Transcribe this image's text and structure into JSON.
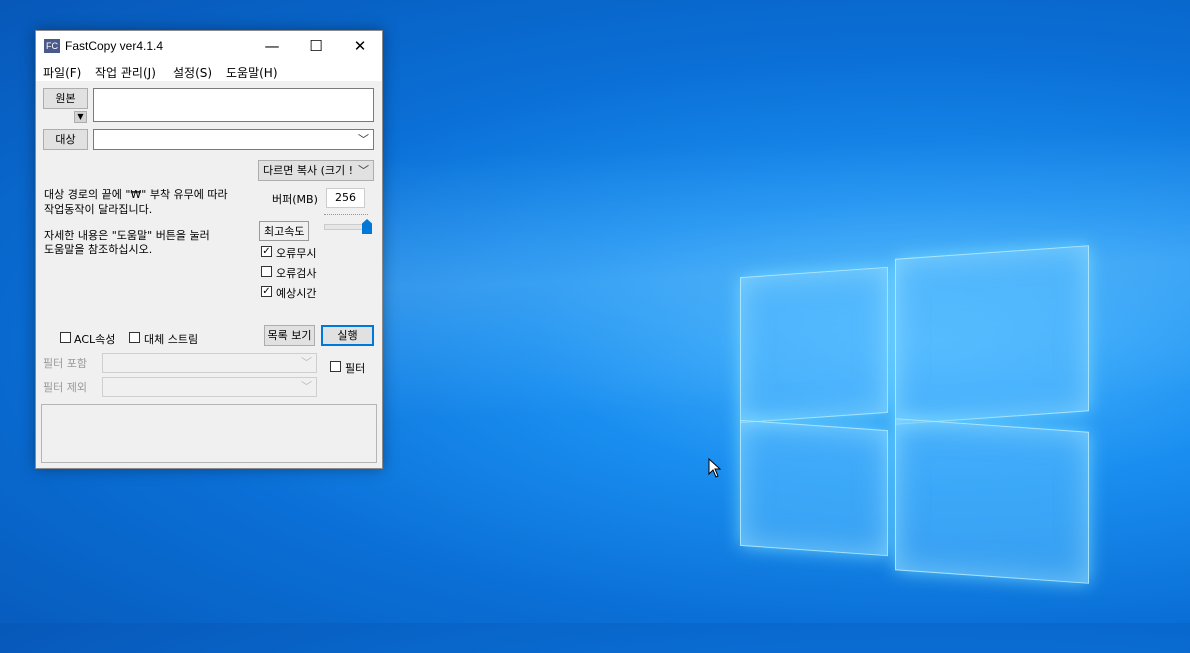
{
  "window": {
    "icon_text": "FC",
    "title": "FastCopy ver4.1.4",
    "minimize": "—",
    "maximize": "☐",
    "close": "✕"
  },
  "menu": [
    "파일(F)",
    "작업 관리(J)",
    "설정(S)",
    "도움말(H)"
  ],
  "source": {
    "button": "원본",
    "value": ""
  },
  "destination": {
    "button": "대상",
    "value": ""
  },
  "mode": {
    "selected": "다르면 복사 (크기 !"
  },
  "info": {
    "line1": "대상 경로의 끝에 \"₩\" 부착 유무에 따라",
    "line2": "작업동작이 달라집니다.",
    "line3": "자세한 내용은 \"도움말\" 버튼을 눌러",
    "line4": "도움말을 참조하십시오."
  },
  "buffer": {
    "label": "버퍼(MB)",
    "value": "256"
  },
  "speed": {
    "label": "최고속도",
    "level": 1.0
  },
  "options": [
    {
      "label": "오류무시",
      "checked": true
    },
    {
      "label": "오류검사",
      "checked": false
    },
    {
      "label": "예상시간",
      "checked": true
    }
  ],
  "acl": {
    "label": "ACL속성",
    "checked": false
  },
  "ads": {
    "label": "대체 스트림",
    "checked": false
  },
  "buttons": {
    "list": "목록 보기",
    "execute": "실행"
  },
  "filter": {
    "include_label": "필터 포함",
    "exclude_label": "필터 제외",
    "enable_label": "필터",
    "checked": false
  },
  "colors": {
    "accent": "#0078d7",
    "desktop": "#0a6fd6"
  }
}
